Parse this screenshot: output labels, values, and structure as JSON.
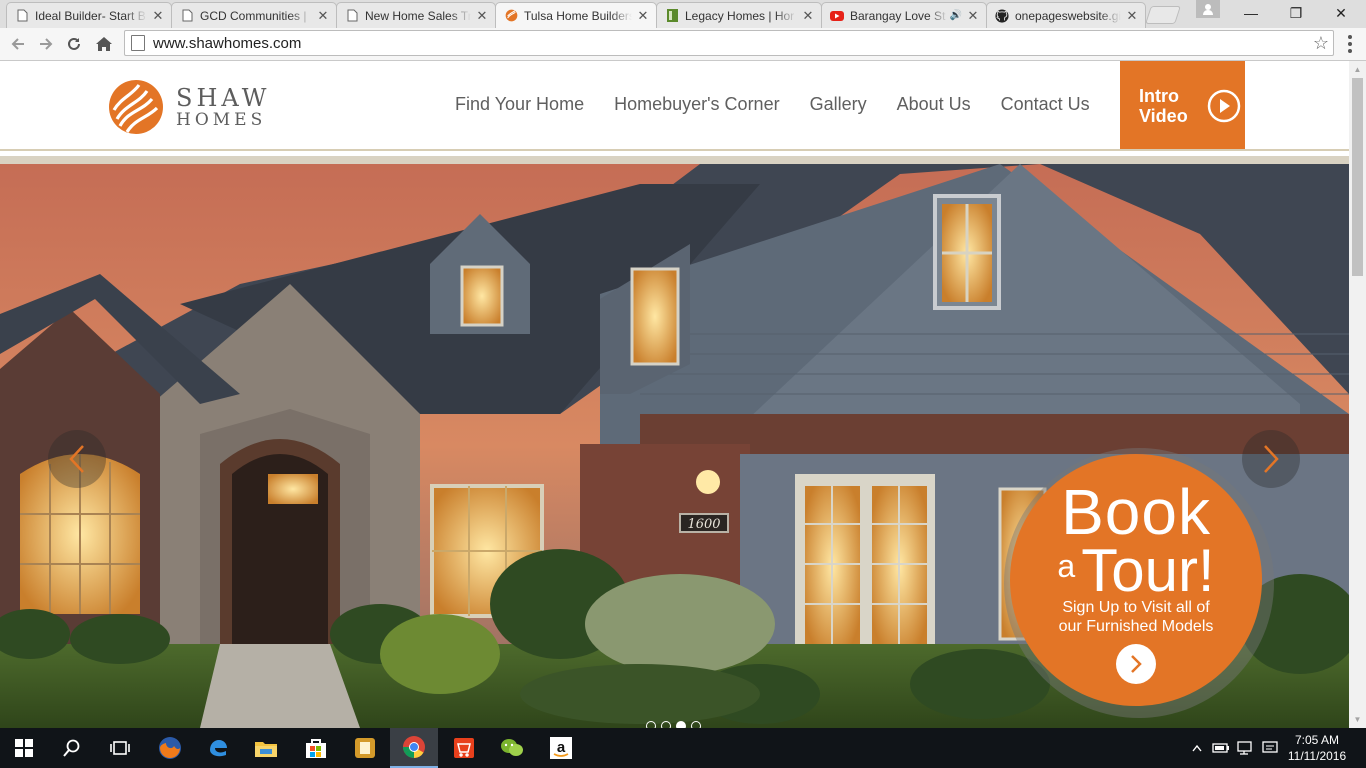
{
  "browser": {
    "tabs": [
      {
        "title": "Ideal Builder- Start B",
        "favicon": "page-icon",
        "active": false
      },
      {
        "title": "GCD Communities |",
        "favicon": "page-icon",
        "active": false
      },
      {
        "title": "New Home Sales Tra",
        "favicon": "page-icon",
        "active": false
      },
      {
        "title": "Tulsa Home Builders",
        "favicon": "shaw-logo-icon",
        "active": true
      },
      {
        "title": "Legacy Homes | Hor",
        "favicon": "legacy-icon",
        "active": false
      },
      {
        "title": "Barangay Love St",
        "favicon": "youtube-icon",
        "active": false,
        "audio": true
      },
      {
        "title": "onepageswebsite.gi",
        "favicon": "github-icon",
        "active": false
      }
    ],
    "close_glyph": "✕",
    "window_controls": {
      "minimize": "—",
      "maximize": "❐",
      "close": "✕"
    },
    "url": "www.shawhomes.com"
  },
  "site": {
    "logo": {
      "line1": "SHAW",
      "line2": "HOMES"
    },
    "nav": [
      "Find Your Home",
      "Homebuyer's Corner",
      "Gallery",
      "About Us",
      "Contact Us"
    ],
    "intro_video": {
      "line1": "Intro",
      "line2": "Video"
    },
    "hero": {
      "house_number": "1600",
      "cta": {
        "title_line1": "Book",
        "title_a": "a",
        "title_line2": "Tour!",
        "subtitle_line1": "Sign Up to Visit all of",
        "subtitle_line2": "our Furnished Models"
      },
      "slides": 4,
      "active_slide": 3
    }
  },
  "taskbar": {
    "apps": [
      "start-icon",
      "search-icon",
      "task-view-icon",
      "firefox-icon",
      "edge-icon",
      "file-explorer-icon",
      "store-icon",
      "app-icon",
      "chrome-icon",
      "shopping-icon",
      "wechat-icon",
      "amazon-icon"
    ],
    "clock": {
      "time": "7:05 AM",
      "date": "11/11/2016"
    }
  },
  "colors": {
    "brand_orange": "#e37526",
    "nav_text": "#5f5f5f",
    "taskbar": "#101418"
  }
}
